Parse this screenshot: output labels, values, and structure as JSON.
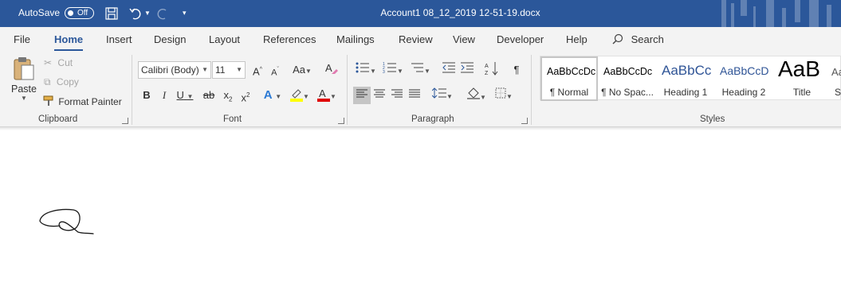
{
  "titlebar": {
    "autosave_label": "AutoSave",
    "autosave_state": "Off",
    "document_title": "Account1 08_12_2019 12-51-19.docx",
    "icons": [
      "save-icon",
      "undo-icon",
      "redo-icon",
      "customize-qat-icon"
    ]
  },
  "menu": {
    "tabs": [
      "File",
      "Home",
      "Insert",
      "Design",
      "Layout",
      "References",
      "Mailings",
      "Review",
      "View",
      "Developer",
      "Help"
    ],
    "active_tab": "Home",
    "search_label": "Search"
  },
  "clipboard": {
    "paste": "Paste",
    "cut": "Cut",
    "copy": "Copy",
    "format_painter": "Format Painter",
    "group_label": "Clipboard"
  },
  "font": {
    "font_name": "Calibri (Body)",
    "font_size": "11",
    "grow": "A",
    "shrink": "A",
    "change_case": "Aa",
    "bold": "B",
    "italic": "I",
    "underline": "U",
    "strike": "ab",
    "subscript": "x",
    "superscript": "x",
    "group_label": "Font",
    "highlight_color": "#ffff00",
    "font_color": "#e00000"
  },
  "paragraph": {
    "group_label": "Paragraph",
    "show_marks": "¶"
  },
  "styles": {
    "group_label": "Styles",
    "items": [
      {
        "preview": "AaBbCcDc",
        "name": "¶ Normal"
      },
      {
        "preview": "AaBbCcDc",
        "name": "¶ No Spac..."
      },
      {
        "preview": "AaBbCc",
        "name": "Heading 1"
      },
      {
        "preview": "AaBbCcD",
        "name": "Heading 2"
      },
      {
        "preview": "AaB",
        "name": "Title"
      },
      {
        "preview": "Aa",
        "name": "S"
      }
    ]
  },
  "colors": {
    "titlebar": "#2b579a",
    "accent": "#2b579a",
    "ribbon": "#f3f3f3",
    "heading": "#2f5496"
  }
}
